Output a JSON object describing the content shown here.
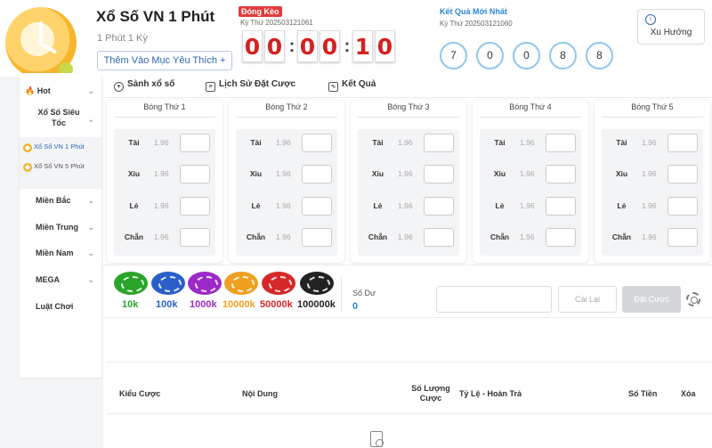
{
  "header": {
    "title": "Xổ Số VN 1 Phút",
    "subtitle": "1 Phút 1 Kỳ",
    "favorite_label": "Thêm Vào Mục Yêu Thích +",
    "status_badge": "Đóng Kèo",
    "current_period": "Kỳ Thứ 202503121061",
    "countdown": [
      "0",
      "0",
      "0",
      "0",
      "1",
      "0"
    ],
    "latest_label": "Kết Quả Mới Nhất",
    "latest_period": "Kỳ Thứ 202503121060",
    "latest_numbers": [
      "7",
      "0",
      "0",
      "8",
      "8"
    ],
    "trend_label": "Xu Hướng",
    "trend_icon": "chart-circle-icon"
  },
  "sidebar": {
    "items": [
      {
        "label": "Hot",
        "icon": "fire-icon"
      },
      {
        "label": "Xổ Số Siêu Tốc"
      },
      {
        "label": "Miền Bắc"
      },
      {
        "label": "Miền Trung"
      },
      {
        "label": "Miền Nam"
      },
      {
        "label": "MEGA"
      },
      {
        "label": "Luật Chơi"
      }
    ],
    "sub_items": [
      {
        "label": "Xổ Số VN 1 Phút",
        "active": true
      },
      {
        "label": "Xổ Số VN 5 Phút",
        "active": false
      }
    ]
  },
  "tabs": [
    {
      "label": "Sảnh xổ số",
      "icon": "globe-icon"
    },
    {
      "label": "Lịch Sử Đặt Cược",
      "icon": "document-icon"
    },
    {
      "label": "Kết Quả",
      "icon": "chart-icon"
    }
  ],
  "balls": [
    {
      "title": "Bóng Thứ 1"
    },
    {
      "title": "Bóng Thứ 2"
    },
    {
      "title": "Bóng Thứ 3"
    },
    {
      "title": "Bóng Thứ 4"
    },
    {
      "title": "Bóng Thứ 5"
    }
  ],
  "bet_options": [
    {
      "name": "Tài",
      "odds": "1.96"
    },
    {
      "name": "Xỉu",
      "odds": "1.96"
    },
    {
      "name": "Lẻ",
      "odds": "1.96"
    },
    {
      "name": "Chẵn",
      "odds": "1.96"
    }
  ],
  "chips": [
    {
      "label": "10k",
      "color": "#2aa52a"
    },
    {
      "label": "100k",
      "color": "#2a5fc9"
    },
    {
      "label": "1000k",
      "color": "#9c2ac9"
    },
    {
      "label": "10000k",
      "color": "#f0a020"
    },
    {
      "label": "50000k",
      "color": "#d62828"
    },
    {
      "label": "100000k",
      "color": "#222222"
    }
  ],
  "bet_panel": {
    "balance_label": "Số Dư",
    "balance_value": "0",
    "reset_label": "Cài Lại",
    "place_label": "Đặt Cược"
  },
  "bet_table": {
    "headers": [
      "Kiểu Cược",
      "Nội Dung",
      "Số Lượng Cược",
      "Tỷ Lệ - Hoàn Trả",
      "Số Tiền",
      "Xóa"
    ]
  }
}
